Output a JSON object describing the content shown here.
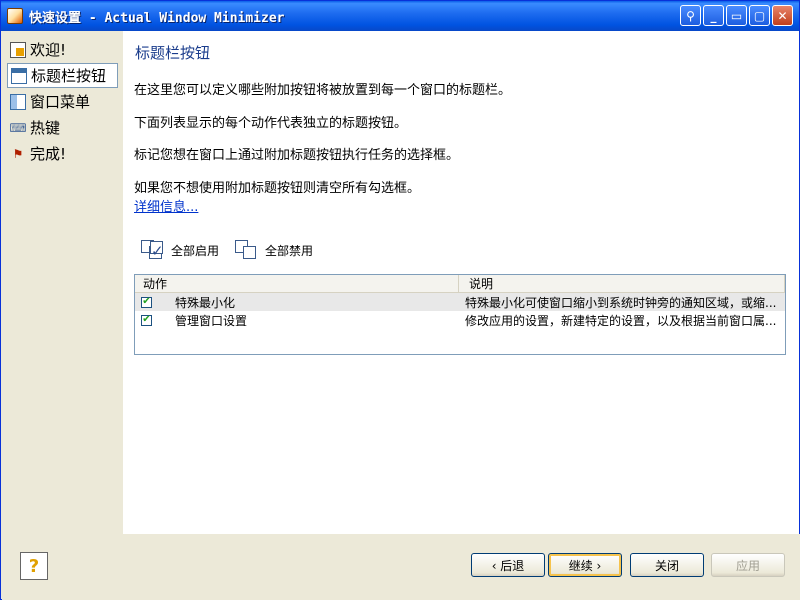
{
  "window": {
    "title": "快速设置 - Actual Window Minimizer",
    "title_buttons": [
      "⚲",
      "_",
      "▭",
      "▢",
      "✕"
    ]
  },
  "sidebar": {
    "items": [
      {
        "label": "欢迎!",
        "icon": "welcome-icon",
        "active": false
      },
      {
        "label": "标题栏按钮",
        "icon": "titlebar-buttons-icon",
        "active": true
      },
      {
        "label": "窗口菜单",
        "icon": "window-menu-icon",
        "active": false
      },
      {
        "label": "热键",
        "icon": "hotkey-icon",
        "active": false
      },
      {
        "label": "完成!",
        "icon": "finish-icon",
        "active": false
      }
    ]
  },
  "main": {
    "title": "标题栏按钮",
    "paragraphs": [
      "在这里您可以定义哪些附加按钮将被放置到每一个窗口的标题栏。",
      "下面列表显示的每个动作代表独立的标题按钮。",
      "标记您想在窗口上通过附加标题按钮执行任务的选择框。",
      "如果您不想使用附加标题按钮则清空所有勾选框。"
    ],
    "more_link": "详细信息...",
    "enable_all": "全部启用",
    "disable_all": "全部禁用",
    "list": {
      "headers": {
        "action": "动作",
        "description": "说明"
      },
      "rows": [
        {
          "checked": true,
          "name": "特殊最小化",
          "description": "特殊最小化可使窗口缩小到系统时钟旁的通知区域，或缩..."
        },
        {
          "checked": true,
          "name": "管理窗口设置",
          "description": "修改应用的设置，新建特定的设置，以及根据当前窗口属..."
        }
      ]
    }
  },
  "footer": {
    "back": "‹ 后退",
    "next": "继续 ›",
    "close": "关闭",
    "apply": "应用"
  },
  "colors": {
    "titlebar": "#0053e1",
    "link": "#0033cc",
    "page_title": "#1a3c8c"
  }
}
